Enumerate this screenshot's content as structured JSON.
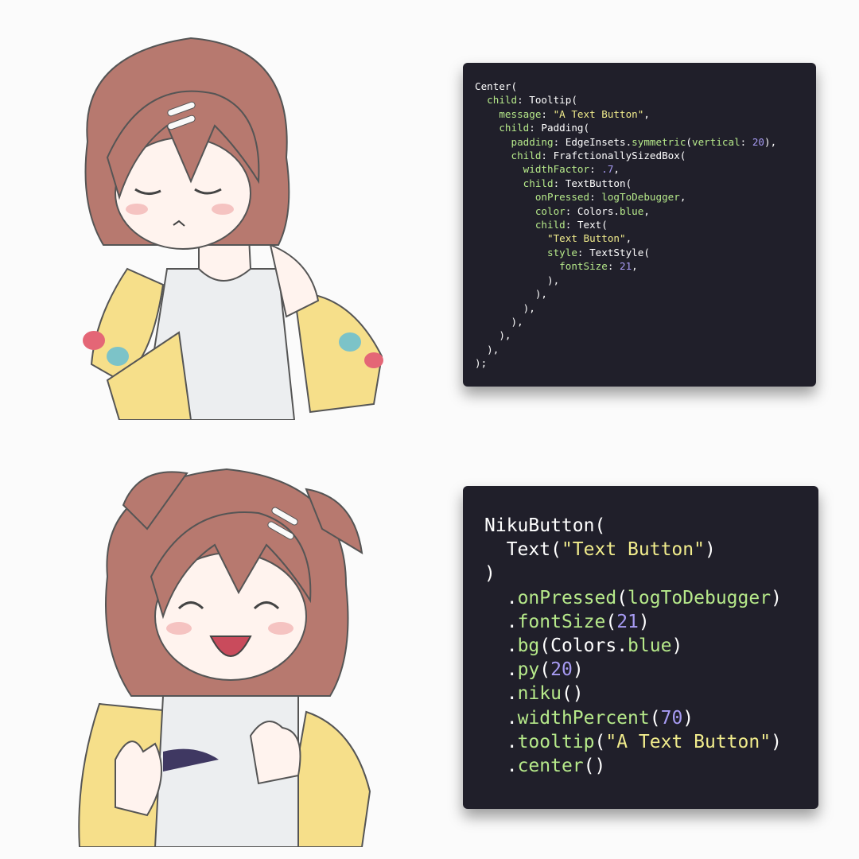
{
  "illustrations": {
    "top": {
      "icon": "chibi-girl-sulking-illustration"
    },
    "bottom": {
      "icon": "chibi-girl-cheering-thumbs-up-illustration"
    }
  },
  "colors": {
    "page_bg": "#fbfbfb",
    "card_bg": "#201f2a",
    "code_text": "#ffffff",
    "code_key": "#b6e98a",
    "code_string": "#f1ec8c",
    "code_number": "#a79bf3"
  },
  "flutter_code": {
    "l01": "Center(",
    "l02_key": "child",
    "l02_rest": ": Tooltip(",
    "l03_key": "message",
    "l03_sep": ": ",
    "l03_str": "\"A Text Button\"",
    "l03_end": ",",
    "l04_key": "child",
    "l04_rest": ": Padding(",
    "l05_key": "padding",
    "l05_a": ": EdgeInsets.",
    "l05_method": "symmetric",
    "l05_b": "(",
    "l05_arg": "vertical",
    "l05_c": ": ",
    "l05_num": "20",
    "l05_end": "),",
    "l06_key": "child",
    "l06_rest": ": FrafctionallySizedBox(",
    "l07_key": "widthFactor",
    "l07_sep": ": ",
    "l07_num": ".7",
    "l07_end": ",",
    "l08_key": "child",
    "l08_rest": ": TextButton(",
    "l09_key": "onPressed",
    "l09_sep": ": ",
    "l09_val": "logToDebugger",
    "l09_end": ",",
    "l10_key": "color",
    "l10_a": ": Colors.",
    "l10_val": "blue",
    "l10_end": ",",
    "l11_key": "child",
    "l11_rest": ": Text(",
    "l12_str": "\"Text Button\"",
    "l12_end": ",",
    "l13_key": "style",
    "l13_rest": ": TextStyle(",
    "l14_key": "fontSize",
    "l14_sep": ": ",
    "l14_num": "21",
    "l14_end": ",",
    "l15": "),",
    "l16": "),",
    "l17": "),",
    "l18": "),",
    "l19": "),",
    "l20": "),",
    "l21": ");"
  },
  "niku_code": {
    "l1": "NikuButton(",
    "l2_a": "Text(",
    "l2_str": "\"Text Button\"",
    "l2_end": ")",
    "l3": ")",
    "l4_dot": ".",
    "l4_m": "onPressed",
    "l4_a": "(",
    "l4_val": "logToDebugger",
    "l4_end": ")",
    "l5_dot": ".",
    "l5_m": "fontSize",
    "l5_a": "(",
    "l5_num": "21",
    "l5_end": ")",
    "l6_dot": ".",
    "l6_m": "bg",
    "l6_a": "(Colors.",
    "l6_val": "blue",
    "l6_end": ")",
    "l7_dot": ".",
    "l7_m": "py",
    "l7_a": "(",
    "l7_num": "20",
    "l7_end": ")",
    "l8_dot": ".",
    "l8_m": "niku",
    "l8_end": "()",
    "l9_dot": ".",
    "l9_m": "widthPercent",
    "l9_a": "(",
    "l9_num": "70",
    "l9_end": ")",
    "l10_dot": ".",
    "l10_m": "tooltip",
    "l10_a": "(",
    "l10_str": "\"A Text Button\"",
    "l10_end": ")",
    "l11_dot": ".",
    "l11_m": "center",
    "l11_end": "()"
  }
}
